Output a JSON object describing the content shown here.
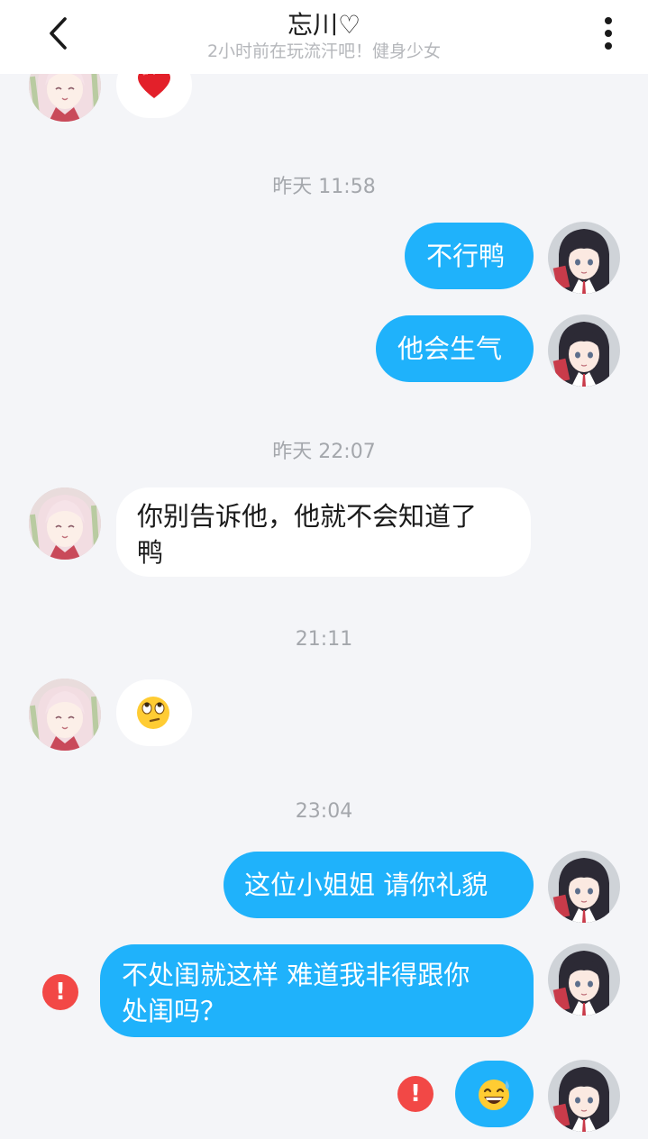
{
  "header": {
    "title": "忘川♡",
    "subtitle": "2小时前在玩流汗吧！健身少女",
    "back_icon": "chevron-left-icon",
    "more_icon": "more-vertical-icon"
  },
  "timestamps": [
    "昨天 11:58",
    "昨天 22:07",
    "21:11",
    "23:04"
  ],
  "messages": {
    "m0": {
      "sender": "other",
      "content": "heart-emoji"
    },
    "m1": {
      "sender": "me",
      "text": "不行鸭"
    },
    "m2": {
      "sender": "me",
      "text": "他会生气"
    },
    "m3": {
      "sender": "other",
      "line1": "你别告诉他，他就不会知道了",
      "line2": "鸭"
    },
    "m4": {
      "sender": "other",
      "content": "eye-roll-emoji"
    },
    "m5": {
      "sender": "me",
      "text": "这位小姐姐 请你礼貌"
    },
    "m6": {
      "sender": "me",
      "line1": "不处闺就这样  难道我非得跟你",
      "line2": "处闺吗？",
      "failed": true
    },
    "m7": {
      "sender": "me",
      "content": "grin-sweat-emoji",
      "failed": true
    }
  },
  "error_mark": "!",
  "colors": {
    "outgoing_bubble": "#1fb2fb",
    "incoming_bubble": "#ffffff",
    "background": "#f4f5f8",
    "error": "#f24846"
  }
}
